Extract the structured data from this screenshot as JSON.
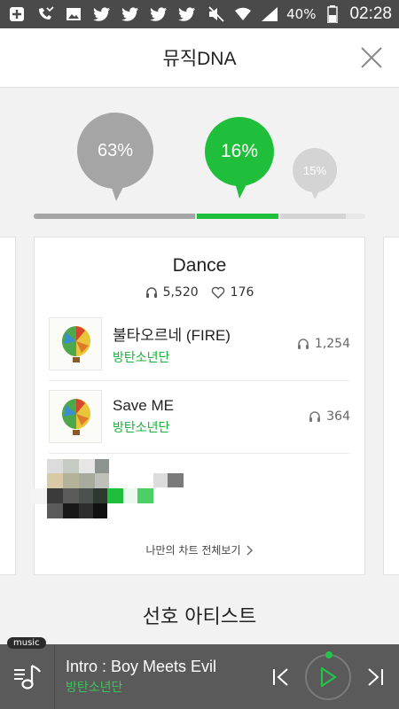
{
  "status_bar": {
    "battery": "40%",
    "time": "02:28",
    "icons": [
      "plus-box-icon",
      "missed-call-icon",
      "image-icon",
      "twitter-icon",
      "twitter-icon",
      "twitter-icon",
      "twitter-icon",
      "mute-icon",
      "wifi-icon",
      "signal-icon",
      "battery-icon"
    ]
  },
  "header": {
    "title": "뮤직DNA",
    "close_icon": "close-icon"
  },
  "dna": {
    "bubbles": [
      {
        "label": "63%",
        "value": 63,
        "color": "#a5a5a5"
      },
      {
        "label": "16%",
        "value": 16,
        "color": "#1fbf3c"
      },
      {
        "label": "15%",
        "value": 15,
        "color": "#d4d4d4"
      }
    ],
    "progress": [
      {
        "value": 0.495,
        "color": "#a5a5a5"
      },
      {
        "value": 0.25,
        "color": "#1fbf3c"
      },
      {
        "value": 0.2,
        "color": "#d4d4d4"
      },
      {
        "value": 0.055,
        "color": "#e8e8e8"
      }
    ]
  },
  "card": {
    "genre": "Dance",
    "plays": "5,520",
    "likes": "176",
    "tracks": [
      {
        "title": "불타오르네 (FIRE)",
        "artist": "방탄소년단",
        "plays": "1,254"
      },
      {
        "title": "Save ME",
        "artist": "방탄소년단",
        "plays": "364"
      }
    ],
    "chart_link": "나만의 차트 전체보기"
  },
  "section": {
    "title": "선호 아티스트"
  },
  "player": {
    "tag": "music",
    "title": "Intro : Boy Meets Evil",
    "artist": "방탄소년단"
  },
  "colors": {
    "accent": "#1fbf3c",
    "artist_green": "#1ab03b",
    "player_bg": "#5a5a5a"
  }
}
